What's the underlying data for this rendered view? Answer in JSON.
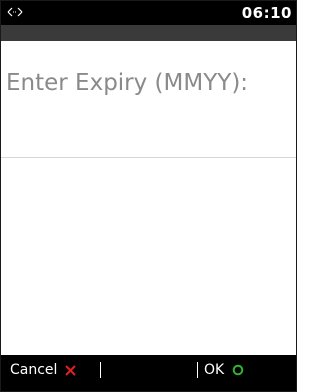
{
  "status_bar": {
    "time": "06:10",
    "signal_icon": "signal-arrows-icon"
  },
  "prompt": {
    "text": "Enter Expiry (MMYY):"
  },
  "softkeys": {
    "cancel_label": "Cancel",
    "cancel_icon": "close-x-icon",
    "cancel_color": "#e02020",
    "ok_label": "OK",
    "ok_icon": "circle-ok-icon",
    "ok_color": "#2fb52f"
  }
}
